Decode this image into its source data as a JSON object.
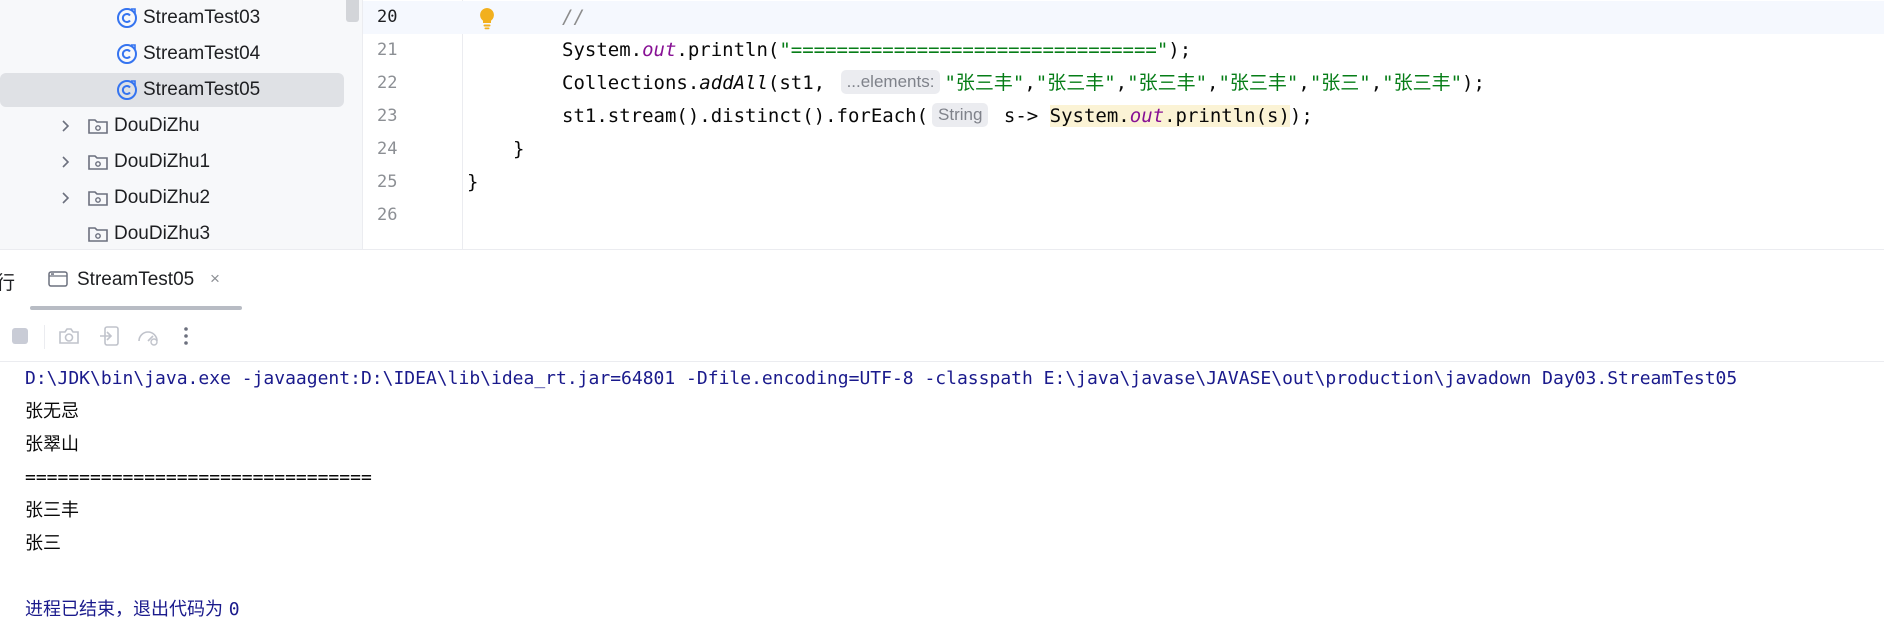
{
  "project_tree": {
    "items": [
      {
        "label": "StreamTest03",
        "kind": "class",
        "selected": false
      },
      {
        "label": "StreamTest04",
        "kind": "class",
        "selected": false
      },
      {
        "label": "StreamTest05",
        "kind": "class",
        "selected": true
      },
      {
        "label": "DouDiZhu",
        "kind": "package",
        "expandable": true
      },
      {
        "label": "DouDiZhu1",
        "kind": "package",
        "expandable": true
      },
      {
        "label": "DouDiZhu2",
        "kind": "package",
        "expandable": true
      },
      {
        "label": "DouDiZhu3",
        "kind": "package",
        "expandable": false
      }
    ]
  },
  "editor": {
    "current_line": "20",
    "line_numbers": [
      "20",
      "21",
      "22",
      "23",
      "24",
      "25",
      "26"
    ],
    "line20": {
      "comment": "//"
    },
    "line21": {
      "prefix": "System.",
      "field": "out",
      "call": ".println(",
      "string": "\"================================\"",
      "suffix": ");"
    },
    "line22": {
      "prefix": "Collections.",
      "method": "addAll",
      "open": "(st1, ",
      "hint": "...elements:",
      "strings": [
        "\"张三丰\"",
        "\"张三丰\"",
        "\"张三丰\"",
        "\"张三丰\"",
        "\"张三\"",
        "\"张三丰\""
      ],
      "suffix": ");"
    },
    "line23": {
      "prefix": "st1.stream().distinct().forEach(",
      "hint": "String",
      "lambda": " s-> ",
      "hl_prefix": "System.",
      "hl_field": "out",
      "hl_call": ".println(s)",
      "suffix": ");"
    },
    "line24": {
      "text": "}"
    },
    "line25": {
      "text": "}"
    },
    "icons": {
      "bulb": "lightbulb-icon"
    }
  },
  "run_window": {
    "title_glyph": "行",
    "tab": {
      "label": "StreamTest05",
      "close": "×"
    },
    "toolbar": [
      "stop-icon",
      "camera-icon",
      "import-icon",
      "profiler-icon",
      "more-icon"
    ],
    "console": {
      "command": "D:\\JDK\\bin\\java.exe -javaagent:D:\\IDEA\\lib\\idea_rt.jar=64801 -Dfile.encoding=UTF-8 -classpath E:\\java\\javase\\JAVASE\\out\\production\\javadown Day03.StreamTest05",
      "lines": [
        "张无忌",
        "张翠山",
        "================================",
        "张三丰",
        "张三"
      ],
      "exit_text": "进程已结束，退出代码为 ",
      "exit_code": "0"
    }
  },
  "colors": {
    "keyword_field": "#871094",
    "string": "#067d17",
    "comment": "#8c8c8c",
    "console_system": "#1a1a8c",
    "selection": "#dfe1e5",
    "bulb": "#f2b01e"
  }
}
